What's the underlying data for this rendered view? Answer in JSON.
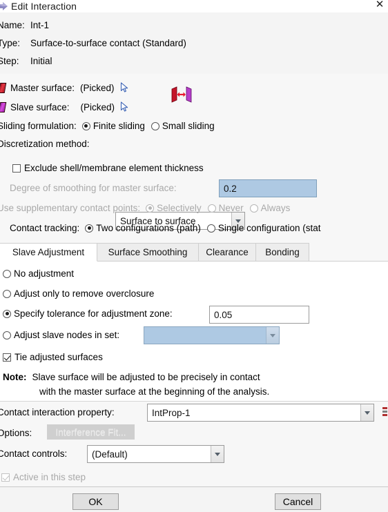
{
  "window": {
    "title": "Edit Interaction",
    "icon": "interaction-arrow-icon",
    "close_label": "✕"
  },
  "header": {
    "name_label": "Name:",
    "name_value": "Int-1",
    "type_label": "Type:",
    "type_value": "Surface-to-surface contact (Standard)",
    "step_label": "Step:",
    "step_value": "Initial"
  },
  "surfaces": {
    "master_label": "Master surface:",
    "master_value": "(Picked)",
    "master_swatch_color": "#e63946",
    "slave_label": "Slave surface:",
    "slave_value": "(Picked)",
    "slave_swatch_color": "#d94fe0",
    "pick_icon": "cursor-pick-icon",
    "contact_graphic": "surface-to-surface-contact-icon"
  },
  "sliding": {
    "label": "Sliding formulation:",
    "options": [
      {
        "label": "Finite sliding",
        "selected": true
      },
      {
        "label": "Small sliding",
        "selected": false
      }
    ]
  },
  "discretization": {
    "label": "Discretization method:",
    "value": "Surface to surface"
  },
  "exclude_thickness": {
    "label": "Exclude shell/membrane element thickness",
    "checked": false
  },
  "smoothing": {
    "label": "Degree of smoothing for master surface:",
    "value": "0.2",
    "disabled": true
  },
  "supplementary": {
    "label": "Use supplementary contact points:",
    "disabled": true,
    "options": [
      {
        "label": "Selectively",
        "selected": true
      },
      {
        "label": "Never",
        "selected": false
      },
      {
        "label": "Always",
        "selected": false
      }
    ]
  },
  "contact_tracking": {
    "label": "Contact tracking:",
    "options": [
      {
        "label": "Two configurations (path)",
        "selected": true
      },
      {
        "label": "Single configuration (stat",
        "selected": false
      }
    ]
  },
  "tabs": [
    {
      "label": "Slave Adjustment",
      "active": true
    },
    {
      "label": "Surface Smoothing",
      "active": false
    },
    {
      "label": "Clearance",
      "active": false
    },
    {
      "label": "Bonding",
      "active": false
    }
  ],
  "slave_adjustment": {
    "options": [
      {
        "label": "No adjustment",
        "selected": false
      },
      {
        "label": "Adjust only to remove overclosure",
        "selected": false
      },
      {
        "label": "Specify tolerance for adjustment zone:",
        "selected": true
      },
      {
        "label": "Adjust slave nodes in set:",
        "selected": false
      }
    ],
    "tolerance_value": "0.05",
    "node_set_value": "",
    "tie_label": "Tie adjusted surfaces",
    "tie_checked": true,
    "note_label": "Note:",
    "note_line1": "Slave surface will be adjusted to be precisely in contact",
    "note_line2": "with the master surface at the beginning of the analysis."
  },
  "bottom": {
    "interaction_property_label": "Contact interaction property:",
    "interaction_property_value": "IntProp-1",
    "options_label": "Options:",
    "interference_button": "Interference Fit...",
    "contact_controls_label": "Contact controls:",
    "contact_controls_value": "(Default)",
    "active_step_label": "Active in this step",
    "active_step_checked": true
  },
  "footer": {
    "ok_label": "OK",
    "cancel_label": "Cancel"
  }
}
